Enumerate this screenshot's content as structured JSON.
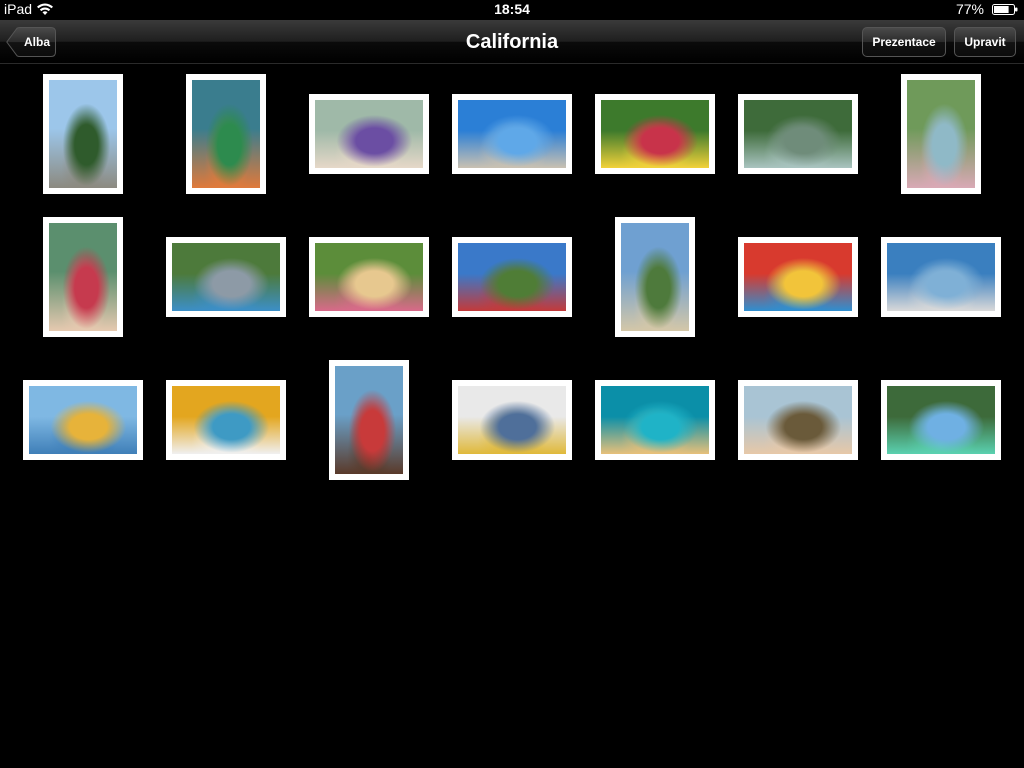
{
  "status_bar": {
    "device": "iPad",
    "time": "18:54",
    "battery_percent": "77%",
    "icons": [
      "wifi-icon",
      "battery-icon"
    ]
  },
  "nav_bar": {
    "back_label": "Alba",
    "title": "California",
    "slideshow_label": "Prezentace",
    "edit_label": "Upravit"
  },
  "photos": [
    {
      "orientation": "portrait",
      "scene": "man sitting on rock by pine trees",
      "colors": [
        "#9cc6ea",
        "#2f5b2c",
        "#8c8a80"
      ]
    },
    {
      "orientation": "portrait",
      "scene": "woman wrapped in green striped towel",
      "colors": [
        "#3a7d8e",
        "#2d8b4e",
        "#e07a3b"
      ]
    },
    {
      "orientation": "landscape",
      "scene": "friends in sunglasses outdoors",
      "colors": [
        "#9fb9a8",
        "#6b4ea3",
        "#e6d8c8"
      ]
    },
    {
      "orientation": "landscape",
      "scene": "man crouching on boulder by lake",
      "colors": [
        "#2b7fd6",
        "#5fa8e8",
        "#c9c1b2"
      ]
    },
    {
      "orientation": "landscape",
      "scene": "woman with sunglasses holding yellow paddle",
      "colors": [
        "#3d7a2c",
        "#c8334a",
        "#f2d23a"
      ]
    },
    {
      "orientation": "landscape",
      "scene": "water skier jumping",
      "colors": [
        "#3e6b3a",
        "#6f8c7a",
        "#a9c4c0"
      ]
    },
    {
      "orientation": "portrait",
      "scene": "woman wading in shallow water",
      "colors": [
        "#6f9a5a",
        "#8fb9c7",
        "#d9a9b5"
      ]
    },
    {
      "orientation": "portrait",
      "scene": "woman in red hoodie",
      "colors": [
        "#5b8f6e",
        "#c63a4e",
        "#e6c9b0"
      ]
    },
    {
      "orientation": "landscape",
      "scene": "man with husky dog",
      "colors": [
        "#4d7a3b",
        "#8d9aa6",
        "#3c8fc8"
      ]
    },
    {
      "orientation": "landscape",
      "scene": "smiling blonde woman in grass",
      "colors": [
        "#5c8d3a",
        "#e7c88f",
        "#d96a8a"
      ]
    },
    {
      "orientation": "landscape",
      "scene": "group of friends on grass",
      "colors": [
        "#3a79c9",
        "#4f7d36",
        "#c33a3a"
      ]
    },
    {
      "orientation": "portrait",
      "scene": "couple sitting on fence",
      "colors": [
        "#6fa0d1",
        "#4e7a3c",
        "#d4c7a8"
      ]
    },
    {
      "orientation": "landscape",
      "scene": "man in colorful inflatable tube",
      "colors": [
        "#d83a2e",
        "#f2c43a",
        "#2f8fd0"
      ]
    },
    {
      "orientation": "landscape",
      "scene": "couple on boat on lake",
      "colors": [
        "#3a7fbf",
        "#7fb0d6",
        "#d9d9d9"
      ]
    },
    {
      "orientation": "landscape",
      "scene": "three friends by lake",
      "colors": [
        "#7fb8e3",
        "#e7b33a",
        "#3f7fb8"
      ]
    },
    {
      "orientation": "landscape",
      "scene": "two friends on boat",
      "colors": [
        "#e3a61f",
        "#3e9ac4",
        "#f0f0f0"
      ]
    },
    {
      "orientation": "portrait",
      "scene": "laughing man in red life vest",
      "colors": [
        "#6aa0c8",
        "#c83a3a",
        "#5a3a2a"
      ]
    },
    {
      "orientation": "landscape",
      "scene": "friends relaxing on boat deck",
      "colors": [
        "#e9e9e9",
        "#4f6f9a",
        "#e0b93a"
      ]
    },
    {
      "orientation": "landscape",
      "scene": "woman floating in turquoise water",
      "colors": [
        "#0b8fa8",
        "#1fb3c7",
        "#e7c07a"
      ]
    },
    {
      "orientation": "landscape",
      "scene": "two smiling friends in hoods",
      "colors": [
        "#a9c4d4",
        "#6a5a3a",
        "#e7c8a8"
      ]
    },
    {
      "orientation": "landscape",
      "scene": "people jumping off rocks",
      "colors": [
        "#3d6a3a",
        "#6fb0e3",
        "#5ad1b0"
      ]
    }
  ]
}
